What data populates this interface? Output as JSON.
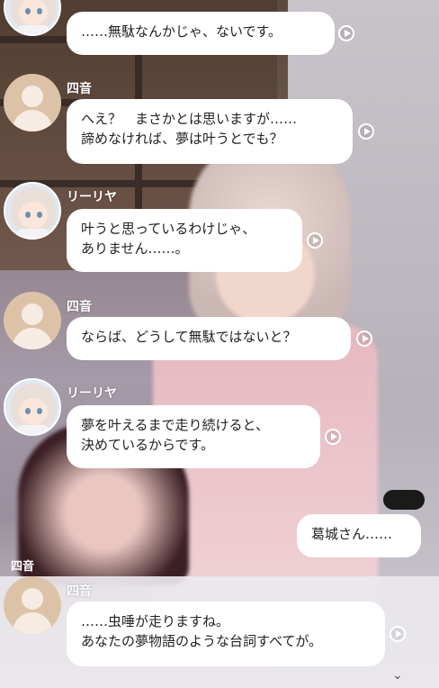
{
  "messages": [
    {
      "speaker": "",
      "text": "……無駄なんかじゃ、ないです。"
    },
    {
      "speaker": "四音",
      "text": "へえ？　まさかとは思いますが……\n諦めなければ、夢は叶うとでも？"
    },
    {
      "speaker": "リーリヤ",
      "text": "叶うと思っているわけじゃ、\nありません……。"
    },
    {
      "speaker": "四音",
      "text": "ならば、どうして無駄ではないと？"
    },
    {
      "speaker": "リーリヤ",
      "text": "夢を叶えるまで走り続けると、\n決めているからです。"
    },
    {
      "speaker": "",
      "text": "葛城さん……"
    },
    {
      "speaker": "四音",
      "text": "……虫唾が走りますね。\nあなたの夢物語のような台詞すべてが。"
    }
  ],
  "background": {
    "panel_label": "四音"
  },
  "icons": {
    "play": "play-icon",
    "avatar_shion": "silhouette-avatar",
    "avatar_lilja": "character-avatar",
    "expand": "chevron-down-icon"
  }
}
